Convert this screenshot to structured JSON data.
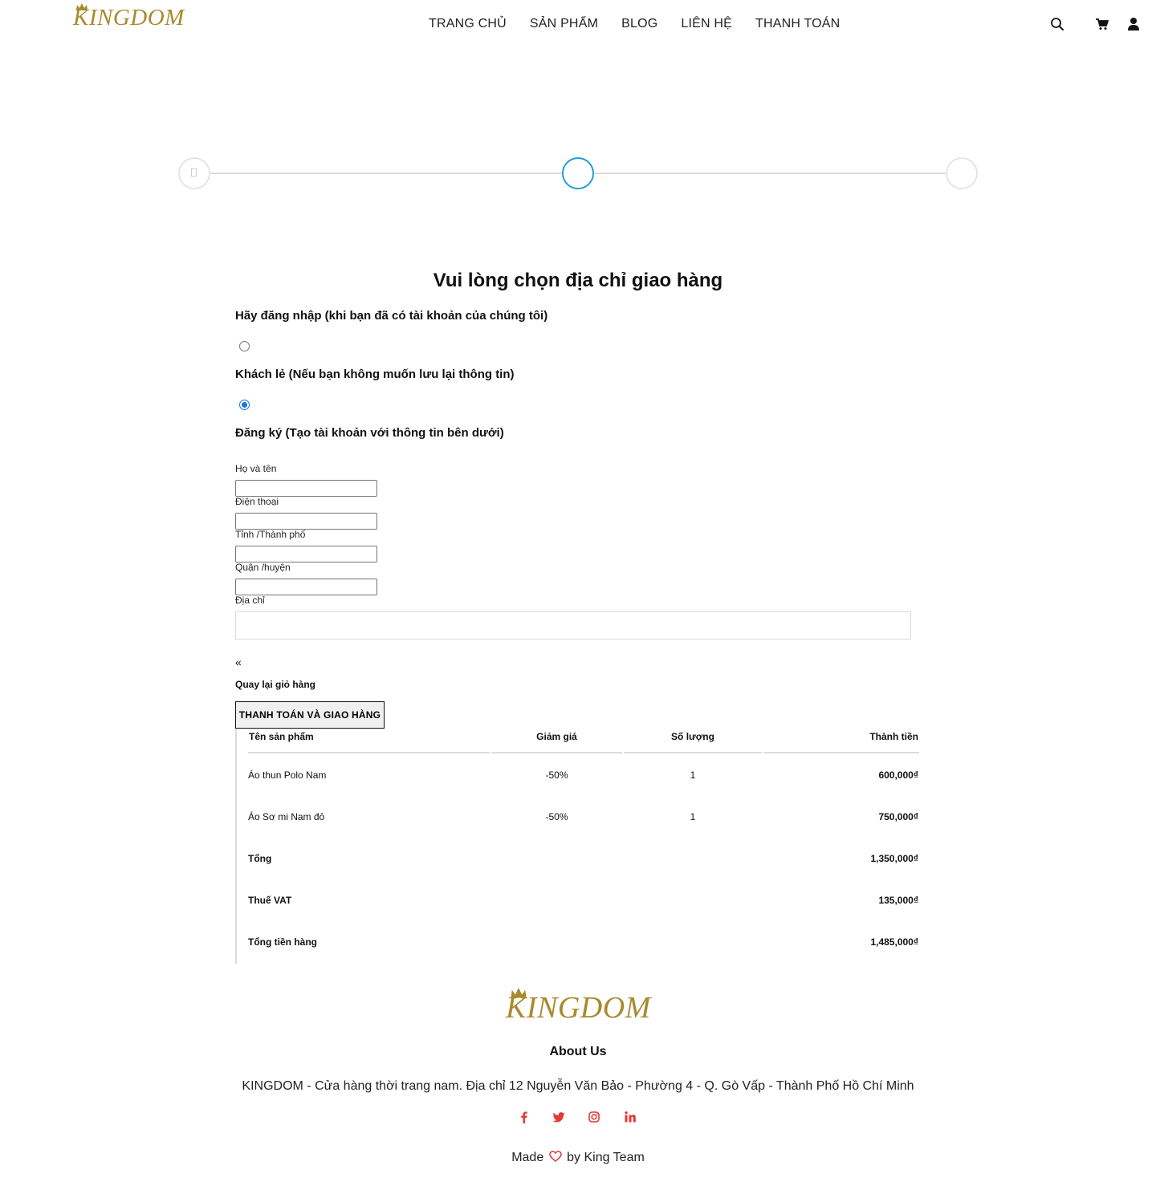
{
  "brand": {
    "logo_text": "KINGDOM",
    "color": "#a88a2c"
  },
  "nav": {
    "items": [
      {
        "label": "TRANG CHỦ"
      },
      {
        "label": "SẢN PHẨM"
      },
      {
        "label": "BLOG"
      },
      {
        "label": "LIÊN HỆ"
      },
      {
        "label": "THANH TOÁN"
      }
    ]
  },
  "header_icons": [
    "search-icon",
    "cart-icon",
    "user-icon"
  ],
  "stepper": {
    "steps": 3,
    "active_step": 2,
    "active_color": "#1ea0d9"
  },
  "form": {
    "title": "Vui lòng chọn địa chỉ giao hàng",
    "option_login": "Hãy đăng nhập (khi bạn đã có tài khoản của chúng tôi)",
    "option_guest": "Khách lẻ (Nếu bạn không muốn lưu lại thông tin)",
    "option_register": "Đăng ký (Tạo tài khoản với thông tin bên dưới)",
    "radio_login_checked": false,
    "radio_guest_checked": true,
    "fields": {
      "name_label": "Họ và tên",
      "phone_label": "Điện thoại",
      "province_label": "Tỉnh /Thành phố",
      "district_label": "Quận /huyện",
      "address_label": "Địa chỉ"
    },
    "back_arrow": "«",
    "back_label": "Quay lại giỏ hàng",
    "submit_label": "THANH TOÁN VÀ GIAO HÀNG"
  },
  "order_table": {
    "headers": {
      "product": "Tên sản phẩm",
      "discount": "Giảm giá",
      "quantity": "Số lượng",
      "amount": "Thành tiền"
    },
    "rows": [
      {
        "product": "Áo thun Polo Nam",
        "discount": "-50%",
        "quantity": "1",
        "amount": "600,000₫"
      },
      {
        "product": "Áo Sơ mi Nam đỏ",
        "discount": "-50%",
        "quantity": "1",
        "amount": "750,000₫"
      }
    ],
    "summary": [
      {
        "label": "Tổng",
        "value": "1,350,000₫"
      },
      {
        "label": "Thuế VAT",
        "value": "135,000₫"
      },
      {
        "label": "Tổng tiền hàng",
        "value": "1,485,000₫"
      }
    ]
  },
  "footer": {
    "logo_text": "KINGDOM",
    "about_title": "About Us",
    "about_text": "KINGDOM - Cửa hàng thời trang nam. Địa chỉ 12 Nguyễn Văn Bảo - Phường 4 - Q. Gò Vấp - Thành Phố Hồ Chí Minh",
    "social_icons": [
      "facebook-icon",
      "twitter-icon",
      "instagram-icon",
      "linkedin-icon"
    ],
    "social_color": "#e53935",
    "made_before": "Made",
    "made_after": "by King Team"
  }
}
